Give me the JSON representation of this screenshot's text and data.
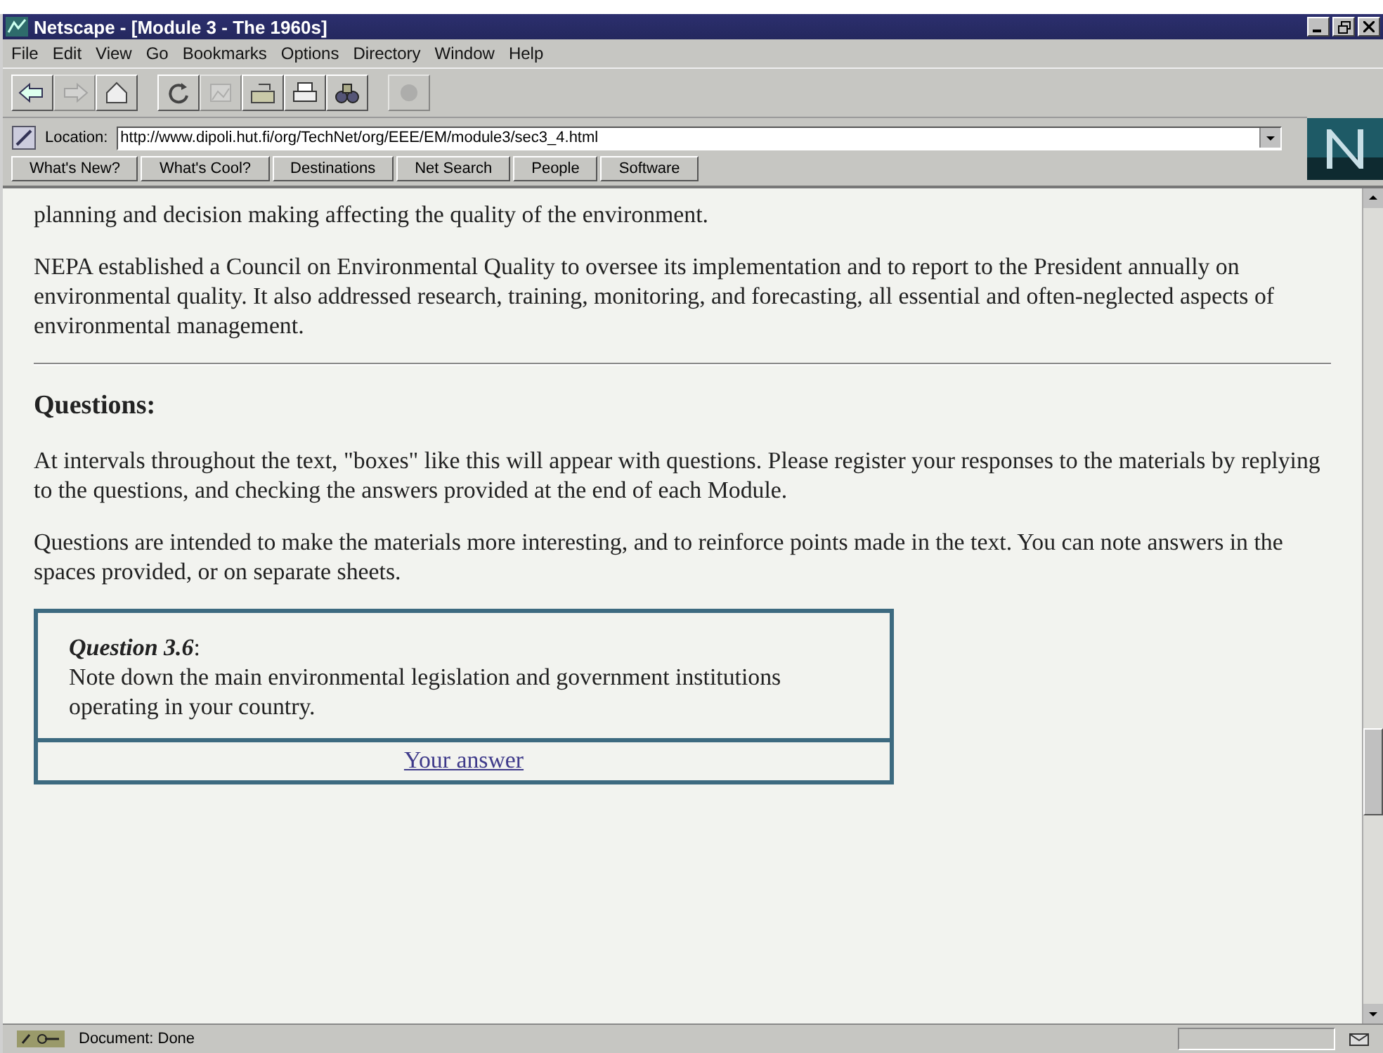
{
  "window": {
    "title": "Netscape - [Module 3 - The 1960s]"
  },
  "menu": [
    "File",
    "Edit",
    "View",
    "Go",
    "Bookmarks",
    "Options",
    "Directory",
    "Window",
    "Help"
  ],
  "toolbar": [
    {
      "kind": "back",
      "disabled": false
    },
    {
      "kind": "forward",
      "disabled": true
    },
    {
      "kind": "home",
      "disabled": false
    },
    {
      "kind": "reload",
      "disabled": false
    },
    {
      "kind": "images",
      "disabled": true
    },
    {
      "kind": "open",
      "disabled": false
    },
    {
      "kind": "print",
      "disabled": false
    },
    {
      "kind": "find",
      "disabled": false
    },
    {
      "kind": "stop",
      "disabled": true
    }
  ],
  "location": {
    "label": "Location:",
    "value": "http://www.dipoli.hut.fi/org/TechNet/org/EEE/EM/module3/sec3_4.html"
  },
  "directory_buttons": [
    "What's New?",
    "What's Cool?",
    "Destinations",
    "Net Search",
    "People",
    "Software"
  ],
  "content": {
    "paragraphs": [
      "planning and decision making affecting the quality of the environment.",
      "NEPA established a Council on Environmental Quality to oversee its implementation and to report to the President annually on environmental quality. It also addressed research, training, monitoring, and forecasting, all essential and often-neglected aspects of environmental management."
    ],
    "heading": "Questions:",
    "paragraphs_2": [
      "At intervals throughout the text, \"boxes\" like this will appear with questions. Please register your responses to the materials by replying to the questions, and checking the answers provided at the end of each Module.",
      "Questions are intended to make the materials more interesting, and to reinforce points made in the text. You can note answers in the spaces provided, or on separate sheets."
    ],
    "question": {
      "title": "Question 3.6",
      "suffix": ":",
      "text": "Note down the main environmental legislation and government institutions operating in your country.",
      "link": "Your answer"
    }
  },
  "status_bar": {
    "text": "Document: Done"
  }
}
